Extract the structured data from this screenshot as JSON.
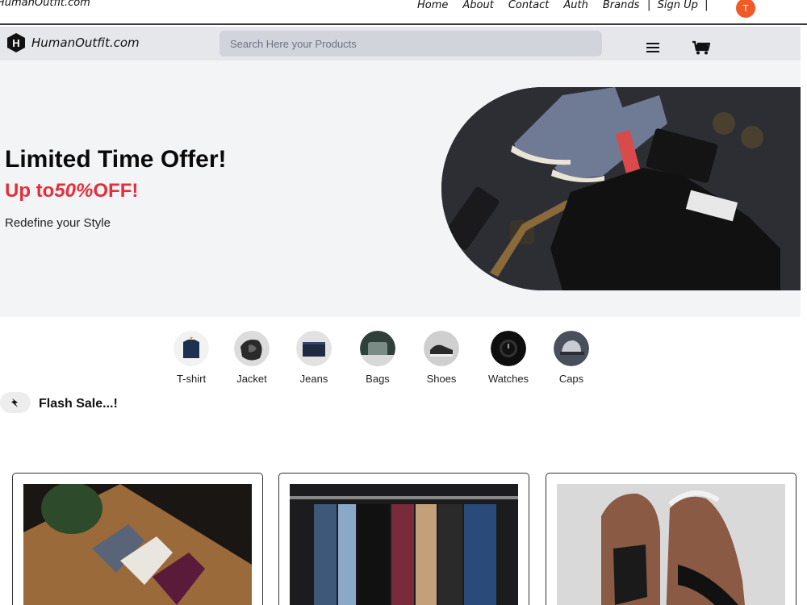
{
  "topbar": {
    "site_name": "HumanOutfit.com",
    "nav": [
      "Home",
      "About",
      "Contact",
      "Auth",
      "Brands"
    ],
    "signup": "|  Sign Up  |",
    "avatar_initial": "T"
  },
  "header": {
    "logo_text": "HumanOutfit.com",
    "logo_letter": "H",
    "search_placeholder": "Search Here your Products"
  },
  "hero": {
    "headline": "Limited Time Offer!",
    "offer_prefix": "Up to",
    "offer_value": "50%",
    "offer_suffix": "OFF!",
    "tagline": "Redefine your Style"
  },
  "categories": [
    {
      "label": "T-shirt",
      "icon": "tshirt-icon"
    },
    {
      "label": "Jacket",
      "icon": "jacket-icon"
    },
    {
      "label": "Jeans",
      "icon": "jeans-icon"
    },
    {
      "label": "Bags",
      "icon": "bag-icon"
    },
    {
      "label": "Shoes",
      "icon": "shoe-icon"
    },
    {
      "label": "Watches",
      "icon": "watch-icon"
    },
    {
      "label": "Caps",
      "icon": "cap-icon"
    }
  ],
  "flash_sale": {
    "title": "Flash Sale...!",
    "icon": "lightning-icon"
  },
  "colors": {
    "accent_red": "#e0303b",
    "avatar_orange": "#f05a28",
    "header_bg": "#e5e7eb",
    "hero_bg": "#f3f4f6"
  }
}
